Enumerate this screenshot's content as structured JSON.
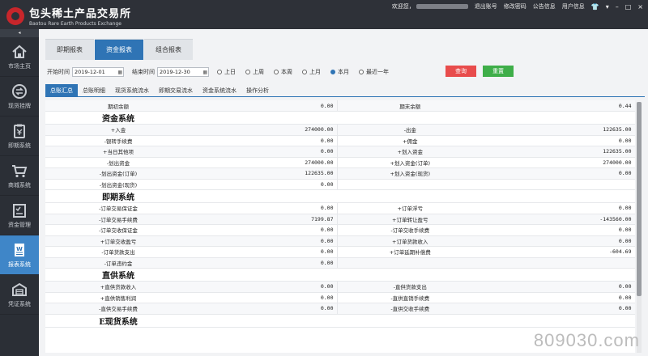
{
  "header": {
    "logo_cn": "包头稀土产品交易所",
    "logo_en": "Baotou Rare Earth Products Exchange",
    "welcome": "欢迎您，",
    "links": [
      "退出账号",
      "修改密码",
      "公告信息",
      "用户信息"
    ],
    "window_controls": [
      "▾",
      "–",
      "□",
      "×"
    ]
  },
  "sidebar": {
    "toggle": "◂",
    "items": [
      {
        "label": "市场主页",
        "icon": "home-icon"
      },
      {
        "label": "现货挂牌",
        "icon": "exchange-icon"
      },
      {
        "label": "即期系统",
        "icon": "clipboard-yen-icon"
      },
      {
        "label": "商城系统",
        "icon": "cart-icon"
      },
      {
        "label": "资金管理",
        "icon": "checklist-icon"
      },
      {
        "label": "报表系统",
        "icon": "word-doc-icon",
        "active": true
      },
      {
        "label": "凭证系统",
        "icon": "warehouse-icon"
      }
    ]
  },
  "tabs": [
    {
      "label": "即期报表"
    },
    {
      "label": "资金报表",
      "active": true
    },
    {
      "label": "组合报表"
    }
  ],
  "filters": {
    "start_label": "开始时间",
    "start_value": "2019-12-01",
    "end_label": "结束时间",
    "end_value": "2019-12-30",
    "radios": [
      {
        "label": "上日"
      },
      {
        "label": "上周"
      },
      {
        "label": "本周"
      },
      {
        "label": "上月"
      },
      {
        "label": "本月",
        "selected": true
      },
      {
        "label": "最近一年"
      }
    ],
    "query": "查询",
    "reset": "重置"
  },
  "subtabs": [
    "总账汇总",
    "总账明细",
    "现货系统流水",
    "即期交易流水",
    "资金系统流水",
    "操作分析"
  ],
  "table": {
    "rows": [
      {
        "l1": "期初余额",
        "v1": "0.00",
        "l2": "期末余额",
        "v2": "0.44"
      },
      {
        "section": "资金系统"
      },
      {
        "l1": "+入金",
        "v1": "274000.00",
        "l2": "-出金",
        "v2": "122635.00"
      },
      {
        "l1": "-银转手续费",
        "v1": "0.00",
        "l2": "+佣金",
        "v2": "0.00"
      },
      {
        "l1": "+当日其他项",
        "v1": "0.00",
        "l2": "+划入资金",
        "v2": "122635.00"
      },
      {
        "l1": "-划出资金",
        "v1": "274000.00",
        "l2": "+划入资金(订单)",
        "v2": "274000.00"
      },
      {
        "l1": "-划出资金(订单)",
        "v1": "122635.00",
        "l2": "+划入资金(现货)",
        "v2": "0.00"
      },
      {
        "l1": "-划出资金(现货)",
        "v1": "0.00",
        "l2": "",
        "v2": ""
      },
      {
        "section": "即期系统"
      },
      {
        "l1": "-订单交易保证金",
        "v1": "0.00",
        "l2": "+订单浮亏",
        "v2": "0.00"
      },
      {
        "l1": "-订单交易手续费",
        "v1": "7199.87",
        "l2": "+订单转让盈亏",
        "v2": "-143560.00"
      },
      {
        "l1": "-订单交收保证金",
        "v1": "0.00",
        "l2": "-订单交收手续费",
        "v2": "0.00"
      },
      {
        "l1": "+订单交收盈亏",
        "v1": "0.00",
        "l2": "+订单货款收入",
        "v2": "0.00"
      },
      {
        "l1": "-订单货款支出",
        "v1": "0.00",
        "l2": "+订单延期补偿费",
        "v2": "-604.69"
      },
      {
        "l1": "-订单违约金",
        "v1": "0.00",
        "l2": "",
        "v2": ""
      },
      {
        "section": "直供系统"
      },
      {
        "l1": "+直供货款收入",
        "v1": "0.00",
        "l2": "-直供货款支出",
        "v2": "0.00"
      },
      {
        "l1": "+直供销售利润",
        "v1": "0.00",
        "l2": "-直供直销手续费",
        "v2": "0.00"
      },
      {
        "l1": "-直供交易手续费",
        "v1": "0.00",
        "l2": "-直供交收手续费",
        "v2": "0.00"
      },
      {
        "section": "E现货系统"
      }
    ]
  },
  "watermark": "809030.com"
}
